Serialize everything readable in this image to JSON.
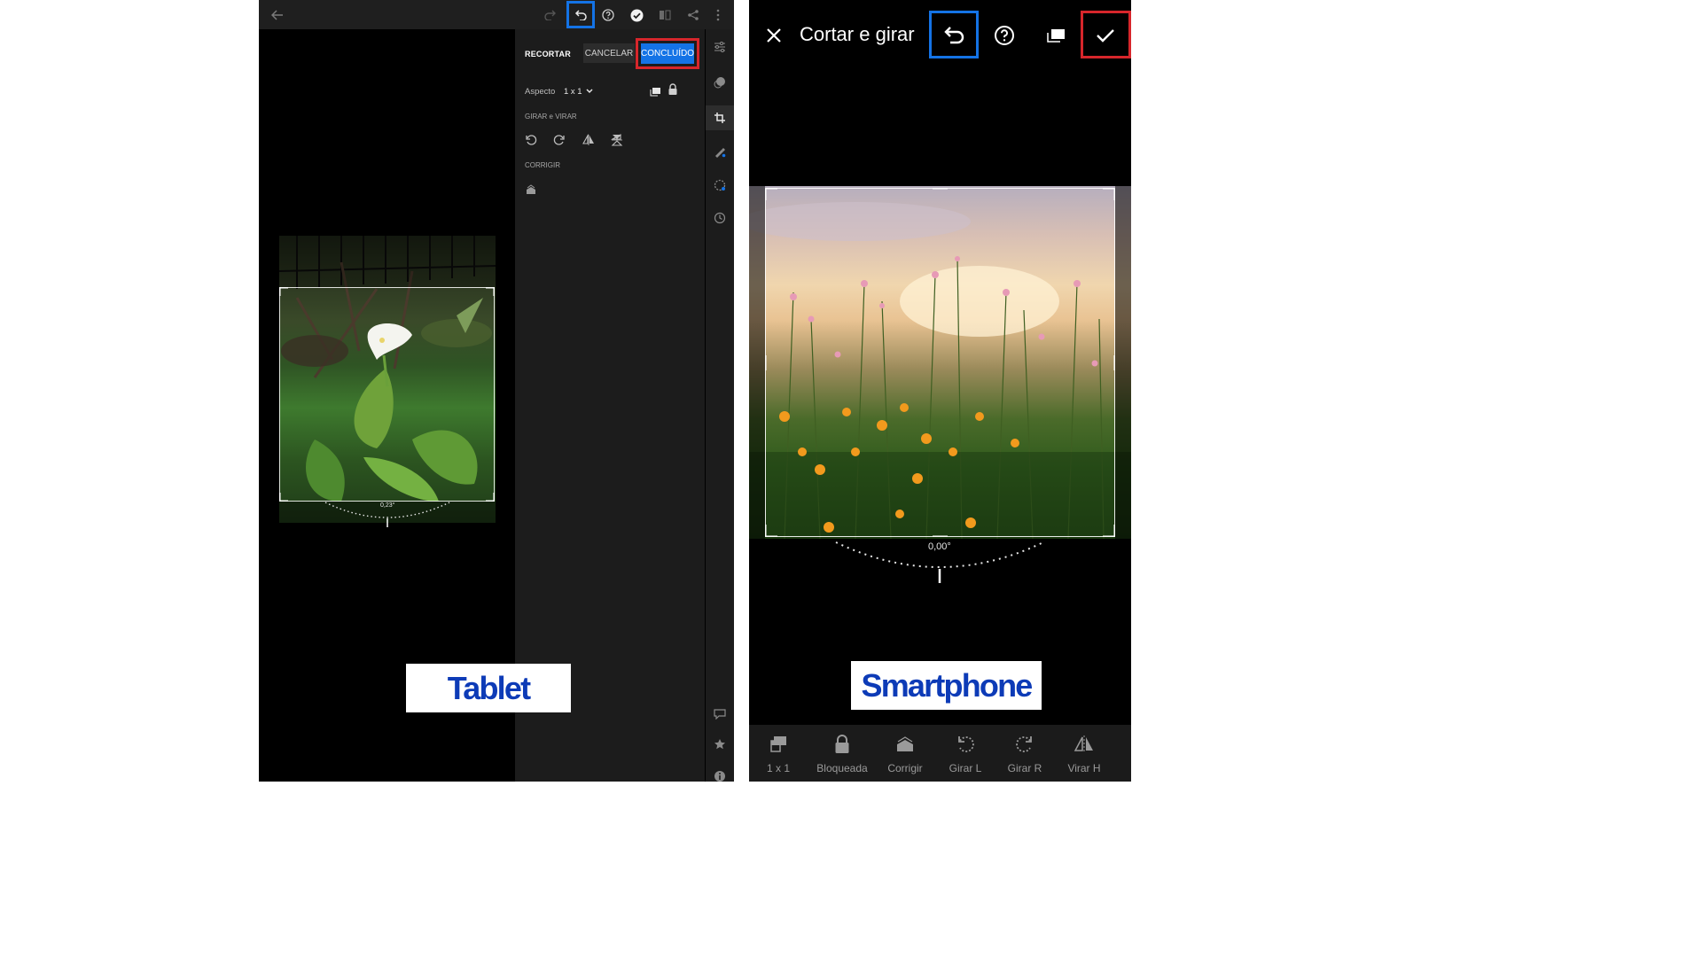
{
  "tablet": {
    "crop_panel": {
      "title": "RECORTAR",
      "cancel_label": "CANCELAR",
      "done_label": "CONCLUÍDO",
      "aspect_label": "Aspecto",
      "aspect_value": "1 x 1",
      "rotate_flip_heading": "GIRAR e VIRAR",
      "correct_heading": "CORRIGIR"
    },
    "angle_readout": "0,23°",
    "photo_alt": "calla lily",
    "device_label": "Tablet"
  },
  "smartphone": {
    "title": "Cortar e girar",
    "angle_readout": "0,00°",
    "photo_alt": "wildflower field at sunset",
    "device_label": "Smartphone",
    "toolbar": [
      {
        "label": "1 x 1",
        "icon": "aspect-ratio-icon"
      },
      {
        "label": "Bloqueada",
        "icon": "lock-icon"
      },
      {
        "label": "Corrigir",
        "icon": "auto-straighten-icon"
      },
      {
        "label": "Girar L",
        "icon": "rotate-left-icon"
      },
      {
        "label": "Girar R",
        "icon": "rotate-right-icon"
      },
      {
        "label": "Virar H",
        "icon": "flip-horizontal-icon"
      }
    ]
  },
  "colors": {
    "accent_blue": "#1473e6",
    "highlight_red": "#d7262b",
    "label_blue": "#0d3bb7"
  }
}
